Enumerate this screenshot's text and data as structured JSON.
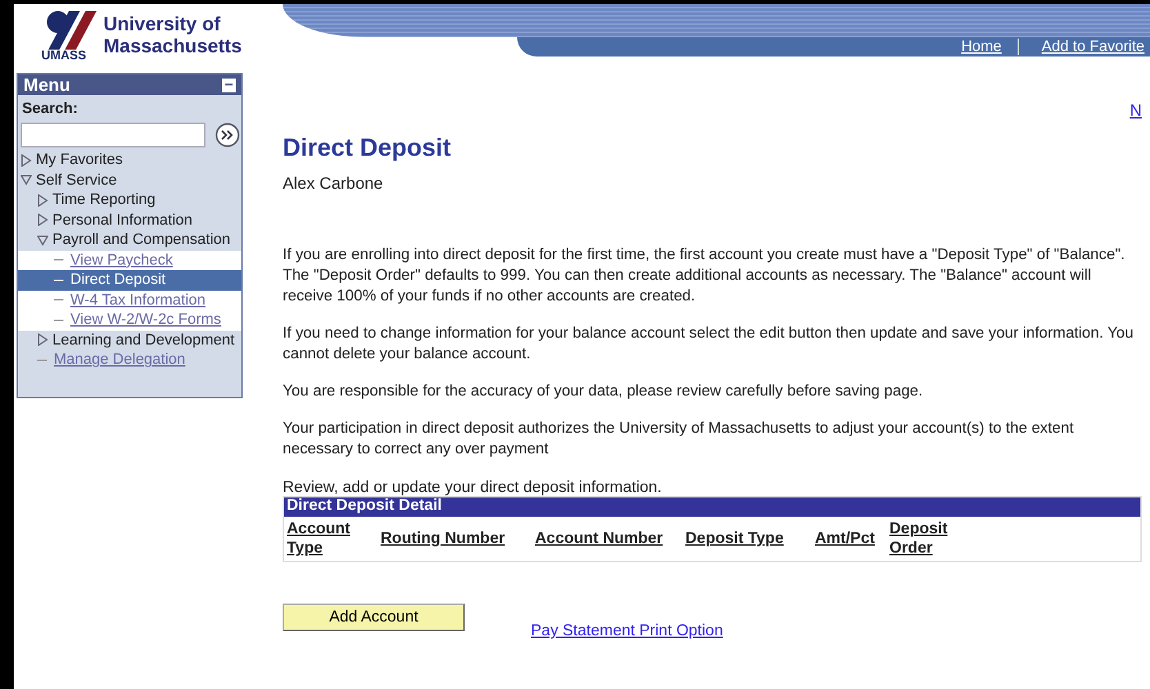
{
  "logo": {
    "line1": "University of",
    "line2": "Massachusetts",
    "mark": "UMASS"
  },
  "header_links": [
    "Home",
    "Add to Favorite"
  ],
  "corner_link": "N",
  "menu": {
    "title": "Menu",
    "collapse": "−",
    "search_label": "Search:",
    "items": [
      {
        "label": "My Favorites",
        "kind": "folder",
        "expanded": false,
        "selected": false
      },
      {
        "label": "Self Service",
        "kind": "folder",
        "expanded": true,
        "selected": false,
        "children": [
          {
            "label": "Time Reporting",
            "kind": "folder",
            "expanded": false,
            "selected": false
          },
          {
            "label": "Personal Information",
            "kind": "folder",
            "expanded": false,
            "selected": false
          },
          {
            "label": "Payroll and Compensation",
            "kind": "folder",
            "expanded": true,
            "selected": false,
            "children": [
              {
                "label": "View Paycheck",
                "kind": "link",
                "selected": false
              },
              {
                "label": "Direct Deposit",
                "kind": "link",
                "selected": true
              },
              {
                "label": "W-4 Tax Information",
                "kind": "link",
                "selected": false
              },
              {
                "label": "View W-2/W-2c Forms",
                "kind": "link",
                "selected": false
              }
            ]
          },
          {
            "label": "Learning and Development",
            "kind": "folder",
            "expanded": false,
            "selected": false
          },
          {
            "label": "Manage Delegation",
            "kind": "link",
            "selected": false
          }
        ]
      }
    ]
  },
  "page": {
    "title": "Direct Deposit",
    "name": "Alex Carbone",
    "paragraphs": [
      "If you are enrolling into direct deposit for the first time, the first account you create must have a \"Deposit Type\" of \"Balance\". The \"Deposit Order\" defaults to 999. You can then create additional accounts as necessary. The \"Balance\" account will receive 100% of your funds if no other accounts are created.",
      "If you need to change information for your balance account select the edit button then update and save your information. You cannot delete your balance account.",
      "You are responsible for the accuracy of your data, please review carefully before saving page.",
      "Your participation in direct deposit authorizes the University of Massachusetts to adjust your account(s) to the extent necessary to correct any over payment"
    ],
    "table_intro": "Review, add or update your direct deposit information.",
    "table": {
      "title": "Direct Deposit Detail",
      "columns": [
        "Account Type",
        "Routing Number",
        "Account Number",
        "Deposit Type",
        "Amt/Pct",
        "Deposit Order"
      ]
    },
    "add_button": "Add Account",
    "print_link": "Pay Statement Print Option"
  }
}
